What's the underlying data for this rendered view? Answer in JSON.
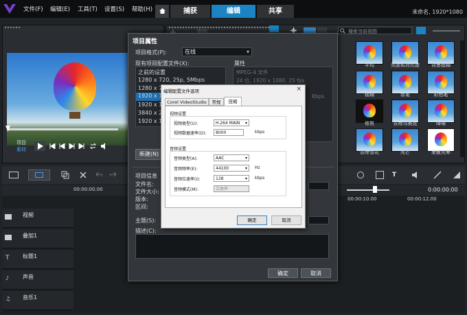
{
  "menu": [
    "文件(F)",
    "编辑(E)",
    "工具(T)",
    "设置(S)",
    "帮助(H)"
  ],
  "tabs": {
    "capture": "捕获",
    "edit": "编辑",
    "share": "共享"
  },
  "project_info": "未命名, 1920*1080",
  "add_label": "添加",
  "search_placeholder": "搜索当前视图",
  "library_labels": [
    "平均",
    "亮度和对比度",
    "背景模糊",
    "模糊",
    "炭笔",
    "彩色笔",
    "修剪",
    "去除马赛克",
    "降噪",
    "去除雪花",
    "光芒",
    "发散光晕"
  ],
  "preview": {
    "project_label": "项目",
    "clip_label": "素材"
  },
  "timeline": {
    "time_start": "00:00:00.00",
    "time_mid": "00:00:10.00",
    "time_end": "00:00:12.00",
    "timecode": "0:00:00:00",
    "tracks": [
      "视频",
      "叠加1",
      "标题1",
      "声音",
      "音乐1"
    ]
  },
  "dialog1": {
    "title": "项目属性",
    "format_label": "项目格式(P):",
    "format_value": "在线",
    "profiles_label": "现有项目配置文件(X):",
    "profiles": [
      "之前的设置",
      "1280 x 720, 25p, 5Mbps",
      "1280 x 7",
      "1920 x 1",
      "1920 x 1",
      "3840 x 2",
      "1920 x 10"
    ],
    "attrs_label": "属性",
    "attrs_line1": "MPEG-4 文件",
    "attrs_line2": "24 位, 1920 x 1080, 25 fps",
    "attrs_line3": "Kbps",
    "new_button": "新建(N)",
    "info_title": "项目信息",
    "info_fields": [
      "文件名:",
      "文件大小:",
      "版本:",
      "区间:"
    ],
    "subject_label": "主题(S):",
    "desc_label": "描述(C):",
    "ok": "确定",
    "cancel": "取消"
  },
  "dialog2": {
    "title": "编辑配置文件选项",
    "tabs": [
      "Corel VideoStudio",
      "常规",
      "压缩"
    ],
    "video_group": "视频设置",
    "video_type_label": "视频类型(U):",
    "video_type_value": "H.264 MAIN",
    "video_rate_label": "视频数据速率(D):",
    "video_rate_value": "8000",
    "video_rate_unit": "kbps",
    "audio_group": "音频设置",
    "audio_type_label": "音频类型(A):",
    "audio_type_value": "AAC",
    "audio_freq_label": "音频频率(E):",
    "audio_freq_value": "44100",
    "audio_freq_unit": "Hz",
    "audio_rate_label": "音频位速率(I):",
    "audio_rate_value": "128",
    "audio_rate_unit": "kbps",
    "audio_mode_label": "音频模式(M):",
    "audio_mode_value": "立体声",
    "ok": "确定",
    "cancel": "取消"
  }
}
